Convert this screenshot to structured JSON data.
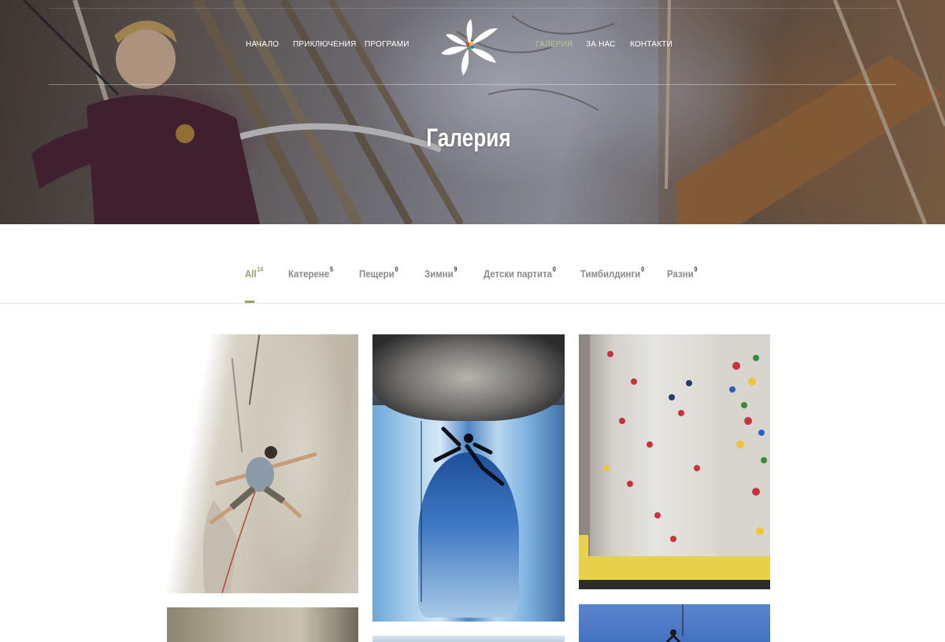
{
  "nav": {
    "left": [
      {
        "label": "НАЧАЛО"
      },
      {
        "label": "ПРИКЛЮЧЕНИЯ"
      },
      {
        "label": "ПРОГРАМИ"
      }
    ],
    "right": [
      {
        "label": "ГАЛЕРИЯ",
        "active": true
      },
      {
        "label": "ЗА НАС"
      },
      {
        "label": "КОНТАКТИ"
      }
    ],
    "active_color": "#b9c98a"
  },
  "hero": {
    "title": "Галерия"
  },
  "filters": {
    "accent_color": "#9aa06a",
    "tabs": [
      {
        "label": "All",
        "count": "14",
        "active": true
      },
      {
        "label": "Катерене",
        "count": "5"
      },
      {
        "label": "Пещери",
        "count": "0"
      },
      {
        "label": "Зимни",
        "count": "9"
      },
      {
        "label": "Детски партита",
        "count": "0"
      },
      {
        "label": "Тимбилдинги",
        "count": "0"
      },
      {
        "label": "Разни",
        "count": "0"
      }
    ]
  },
  "gallery": {
    "items": [
      {
        "subject": "rock-climber-on-cliff"
      },
      {
        "subject": "ice-cave-climber"
      },
      {
        "subject": "indoor-climbing-wall"
      },
      {
        "subject": "rock-face"
      },
      {
        "subject": "winter-landscape"
      },
      {
        "subject": "climber-blue-sky"
      }
    ]
  }
}
